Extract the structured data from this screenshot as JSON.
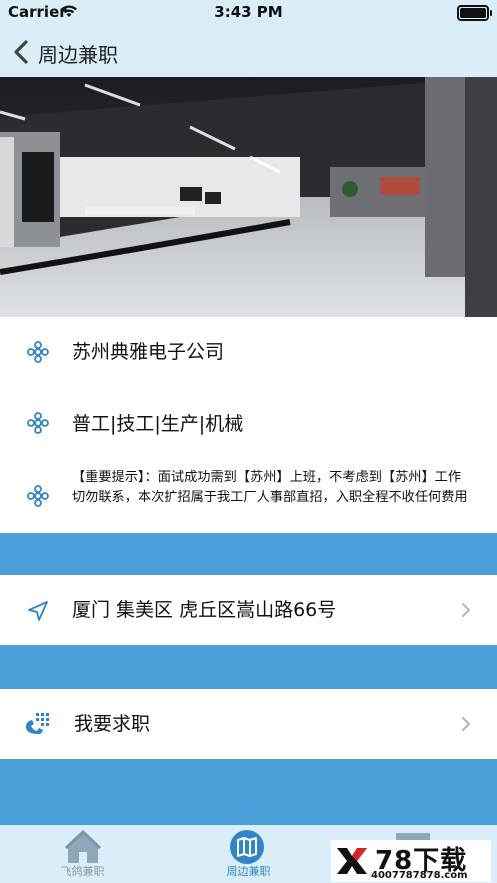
{
  "status_bar": {
    "carrier": "Carrier",
    "time": "3:43 PM"
  },
  "nav": {
    "title": "周边兼职"
  },
  "info": {
    "company": "苏州典雅电子公司",
    "category": "普工|技工|生产|机械",
    "notice": "【重要提示】：面试成功需到【苏州】上班，不考虑到【苏州】工作切勿联系，本次扩招属于我工厂人事部直招，入职全程不收任何费用"
  },
  "address": {
    "text": "厦门 集美区 虎丘区嵩山路66号"
  },
  "apply": {
    "text": "我要求职"
  },
  "tabs": [
    {
      "label": "飞鸽兼职"
    },
    {
      "label": "周边兼职"
    },
    {
      "label": ""
    }
  ],
  "watermark": {
    "big": "78下载",
    "small": "4007787878.com"
  },
  "colors": {
    "accent": "#2e86c8",
    "separator": "#4a9fd8",
    "bar_bg": "#d9eef8"
  }
}
